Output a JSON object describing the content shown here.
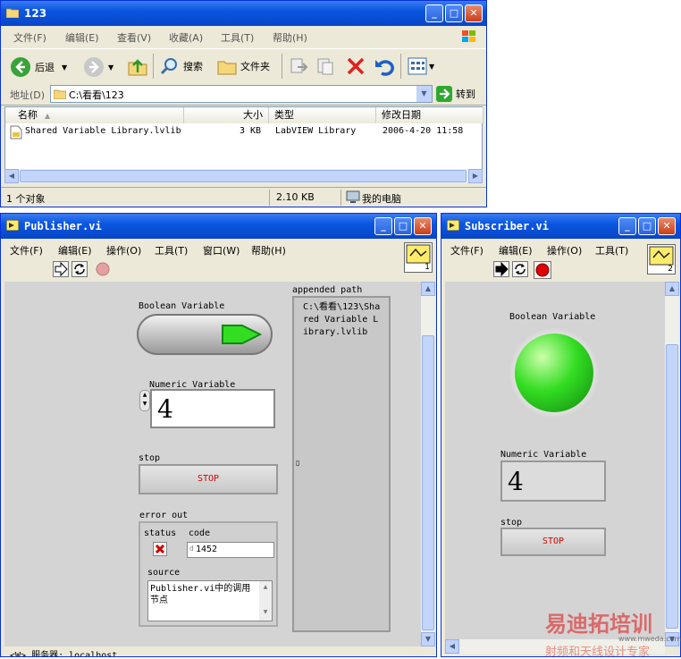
{
  "explorer": {
    "title": "123",
    "menu": [
      "文件(F)",
      "编辑(E)",
      "查看(V)",
      "收藏(A)",
      "工具(T)",
      "帮助(H)"
    ],
    "toolbar": {
      "back": "后退",
      "search": "搜索",
      "folders": "文件夹"
    },
    "address_label": "地址(D)",
    "address_value": "C:\\看看\\123",
    "go_label": "转到",
    "columns": [
      "名称",
      "大小",
      "类型",
      "修改日期"
    ],
    "rows": [
      {
        "name": "Shared Variable Library.lvlib",
        "size": "3 KB",
        "type": "LabVIEW Library",
        "modified": "2006-4-20 11:58"
      }
    ],
    "status": {
      "count": "1 个对象",
      "size": "2.10 KB",
      "location": "我的电脑"
    }
  },
  "publisher": {
    "title": "Publisher.vi",
    "menu": [
      "文件(F)",
      "编辑(E)",
      "操作(O)",
      "工具(T)",
      "窗口(W)",
      "帮助(H)"
    ],
    "connector_number": "1",
    "boolean_label": "Boolean Variable",
    "numeric_label": "Numeric Variable",
    "numeric_value": "4",
    "stop_label": "stop",
    "stop_text": "STOP",
    "error_out_label": "error out",
    "status_label": "status",
    "code_label": "code",
    "code_value": "1452",
    "code_prefix": "d",
    "source_label": "source",
    "source_value": "Publisher.vi中的调用节点",
    "appended_label": "appended path",
    "appended_value": "C:\\看看\\123\\Shared Variable Library.lvlib",
    "statusbar": "<W> 服务器: localhost"
  },
  "subscriber": {
    "title": "Subscriber.vi",
    "menu": [
      "文件(F)",
      "编辑(E)",
      "操作(O)",
      "工具(T)"
    ],
    "connector_number": "2",
    "boolean_label": "Boolean Variable",
    "numeric_label": "Numeric Variable",
    "numeric_value": "4",
    "stop_label": "stop",
    "stop_text": "STOP"
  },
  "watermark": {
    "brand": "易迪拓培训",
    "slogan": "射频和天线设计专家",
    "site": "www.mweda.com"
  },
  "colors": {
    "title_blue": "#0a56e0",
    "led_green": "#33dd22",
    "stop_red": "#dd0000"
  }
}
